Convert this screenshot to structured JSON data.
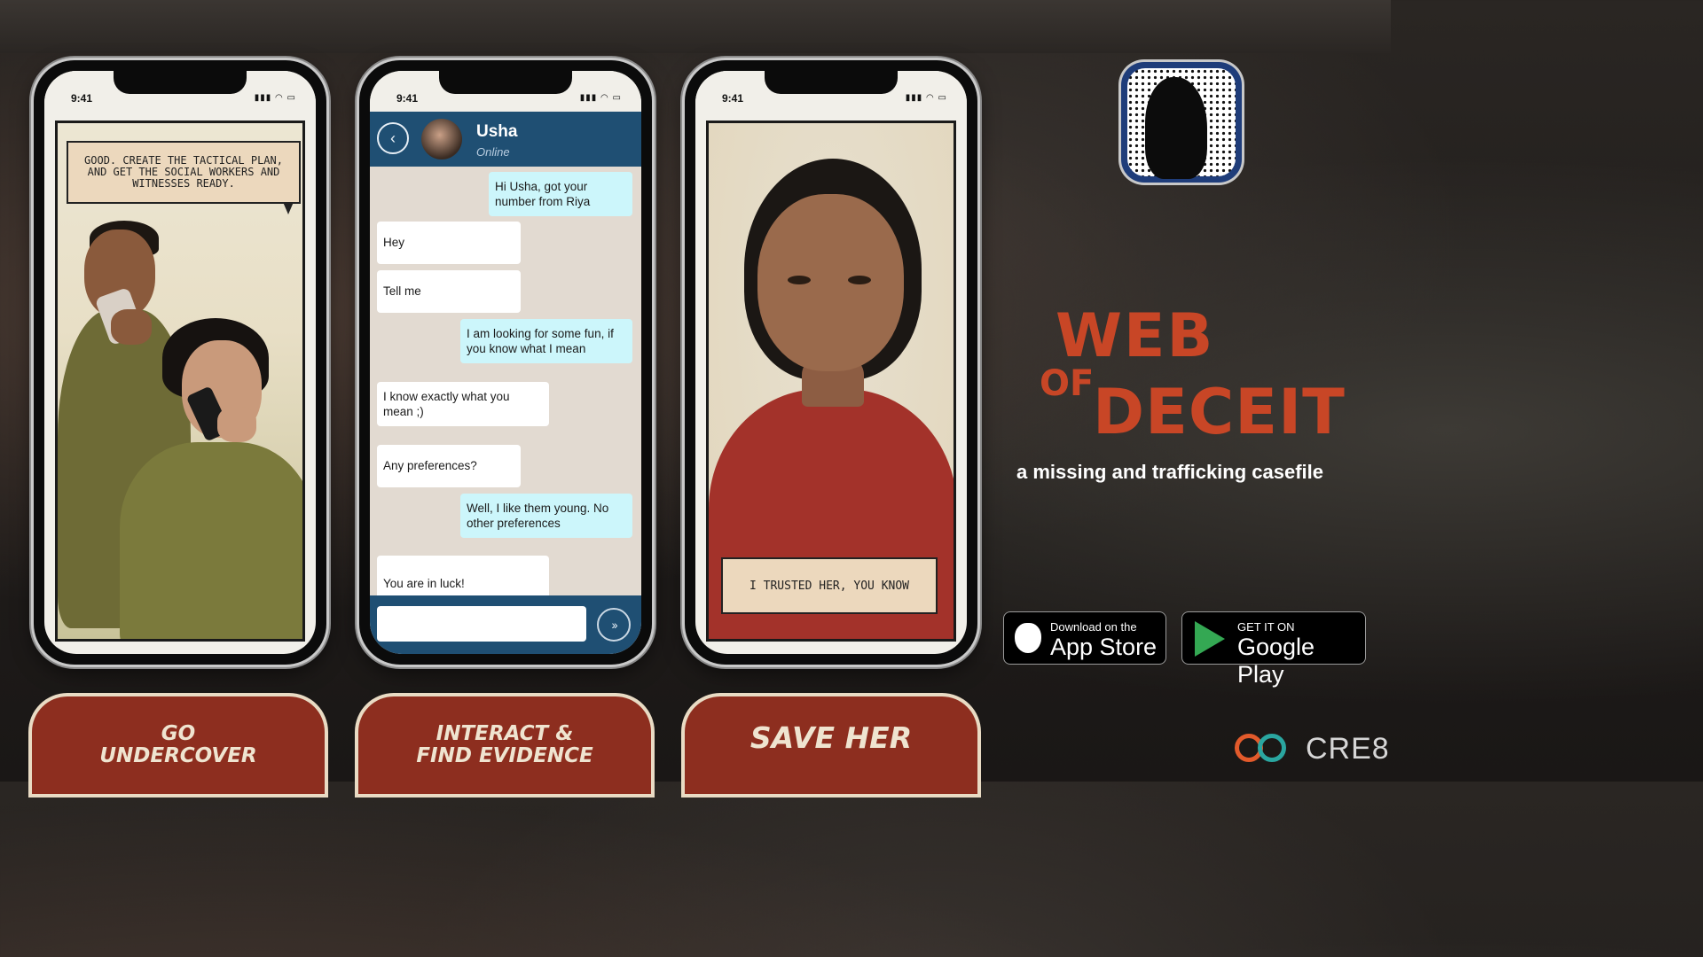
{
  "phone_time": "9:41",
  "phones": {
    "p1": {
      "speech": "Good. Create the tactical plan, and get the social workers and witnesses ready."
    },
    "p3": {
      "caption": "I trusted her, you know"
    }
  },
  "chat": {
    "contact_name": "Usha",
    "contact_status": "Online",
    "messages": [
      {
        "dir": "out",
        "text": "Hi Usha, got your number from Riya"
      },
      {
        "dir": "in",
        "text": "Hey"
      },
      {
        "dir": "in",
        "text": "Tell me"
      },
      {
        "dir": "out",
        "text": "I am looking for some fun, if you know what I mean"
      },
      {
        "dir": "in",
        "text": "I know exactly what you mean ;)"
      },
      {
        "dir": "in",
        "text": "Any preferences?"
      },
      {
        "dir": "out",
        "text": "Well, I like them young. No other preferences"
      },
      {
        "dir": "in",
        "text": "You are in luck!"
      }
    ],
    "input_value": "",
    "input_placeholder": ""
  },
  "tabs": [
    {
      "line1": "Go",
      "line2": "Undercover"
    },
    {
      "line1": "Interact &",
      "line2": "Find Evidence"
    },
    {
      "line1": "Save Her",
      "line2": ""
    }
  ],
  "title": {
    "web": "WEB",
    "of": "OF",
    "deceit": "DECEIT"
  },
  "tagline": "a missing and trafficking casefile",
  "stores": {
    "apple": {
      "small": "Download on the",
      "big": "App Store"
    },
    "google": {
      "small": "GET IT ON",
      "big": "Google Play"
    }
  },
  "brand": "CRE8",
  "colors": {
    "accent": "#c84626",
    "chat_header": "#1f4f73",
    "tab_bg": "#8d2e1f",
    "bubble_out": "#ccf6fb"
  }
}
